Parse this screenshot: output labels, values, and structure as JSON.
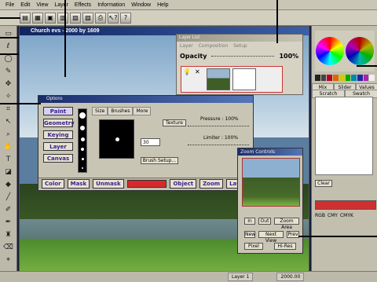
{
  "menubar": {
    "items": [
      "File",
      "Edit",
      "View",
      "Layer",
      "Effects",
      "Information",
      "Window",
      "Help"
    ]
  },
  "canvas": {
    "title": "Church evs - 2000 by 1609"
  },
  "layer_list": {
    "title": "Layer List",
    "menu": [
      "Layer",
      "Composition",
      "Setup"
    ],
    "opacity_label": "Opacity",
    "opacity_value": "100%"
  },
  "color_panel": {
    "tabs_row1": [
      "Mix",
      "Slider",
      "Values"
    ],
    "tabs_row2": [
      "Scratch",
      "Swatch"
    ],
    "clear_label": "Clear",
    "modes": [
      "RGB",
      "CMY",
      "CMYK"
    ]
  },
  "options": {
    "title": "Options",
    "mode_buttons": [
      "Paint",
      "Geometry",
      "Keying",
      "Layer",
      "Canvas"
    ],
    "tabs": [
      "Size",
      "Brushes",
      "More"
    ],
    "texture_label": "Texture",
    "pressure_label": "Pressure : 100%",
    "limiter_label": "Limiter : 100%",
    "size_value": "30",
    "brush_setup_label": "Brush Setup...",
    "bottom": {
      "color": "Color",
      "mask": "Mask",
      "unmask": "Unmask",
      "object": "Object",
      "zoom": "Zoom",
      "layers": "Layers"
    }
  },
  "zoom": {
    "title": "Zoom Controls",
    "in": "In",
    "out": "Out",
    "zoom_area": "Zoom Area",
    "new": "New",
    "next_view": "Next View",
    "prev": "Prev",
    "pixel": "Pixel",
    "hi_res": "Hi-Res"
  },
  "status": {
    "layer": "Layer 1",
    "size": "2000.00"
  },
  "colors": {
    "accent_red": "#d62a2a",
    "title_blue": "#1a2c68",
    "button_text": "#3a1f8c"
  }
}
